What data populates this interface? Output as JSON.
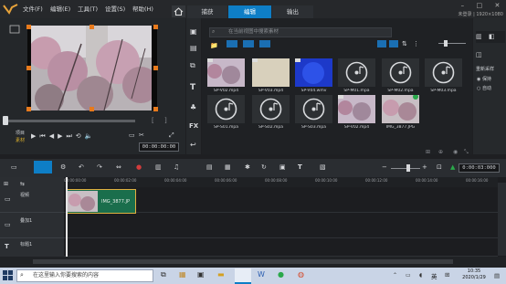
{
  "menu": [
    "文件(F)",
    "编辑(E)",
    "工具(T)",
    "设置(S)",
    "帮助(H)"
  ],
  "tabs": {
    "capture": "捕获",
    "edit": "编辑",
    "share": "输出"
  },
  "window": {
    "minimize": "–",
    "maximize": "□",
    "close": "✕"
  },
  "user_info": "未登录 | 1920×1080",
  "player": {
    "project_mode": "项目",
    "clip_mode": "素材",
    "timecode": "00:00:00:00"
  },
  "library": {
    "search_placeholder": "在当前视图中搜索素材",
    "items": [
      {
        "name": "SP-V02.mp4",
        "kind": "video-flowers"
      },
      {
        "name": "SP-V03.mp4",
        "kind": "video-beige"
      },
      {
        "name": "SP-V04.wmv",
        "kind": "video-blue"
      },
      {
        "name": "SP-M01.mpa",
        "kind": "audio"
      },
      {
        "name": "SP-M02.mpa",
        "kind": "audio"
      },
      {
        "name": "SP-M03.mpa",
        "kind": "audio"
      },
      {
        "name": "SP-S01.mpa",
        "kind": "audio"
      },
      {
        "name": "SP-S02.mpa",
        "kind": "audio"
      },
      {
        "name": "SP-S03.mpa",
        "kind": "audio"
      },
      {
        "name": "SP-V02.mp4",
        "kind": "video-flowers"
      },
      {
        "name": "IMG_3877.JPG",
        "kind": "image"
      }
    ]
  },
  "right_panel": {
    "title": "重新采样",
    "opt1": "保持",
    "opt2": "自动"
  },
  "timeline": {
    "time": "0:00:03:000",
    "ruler": [
      "00:00:00:00",
      "00:00:02:00",
      "00:00:04:00",
      "00:00:06:00",
      "00:00:08:00",
      "00:00:10:00",
      "00:00:12:00",
      "00:00:14:00",
      "00:00:16:00"
    ],
    "tracks": [
      {
        "label": "视频"
      },
      {
        "label": "叠加1"
      },
      {
        "label": "标题1"
      }
    ],
    "clip_name": "IMG_3877.JP"
  },
  "taskbar": {
    "search_placeholder": "在这里输入你要搜索的内容",
    "ime": "英",
    "time": "10:35",
    "date": "2020/1/29"
  },
  "colors": {
    "accent": "#0e7ec6",
    "handle": "#e87a1c",
    "clip": "#1a6e4c"
  }
}
